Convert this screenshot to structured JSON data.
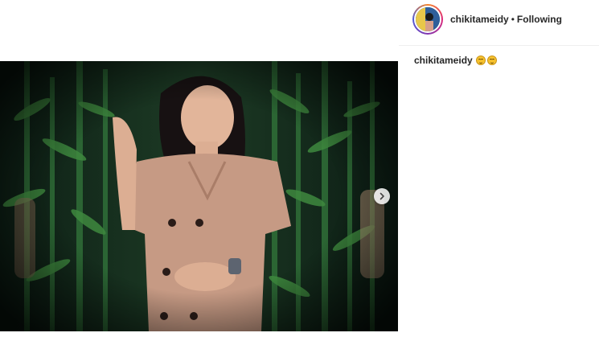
{
  "post": {
    "username": "chikitameidy",
    "separator": "•",
    "follow_status": "Following"
  },
  "caption": {
    "username": "chikitameidy",
    "emojis": [
      "grinning-face-emoji",
      "grinning-face-emoji"
    ]
  },
  "media": {
    "description_icon": "photo",
    "next_icon": "chevron-right-icon"
  },
  "colors": {
    "text": "#262626",
    "border": "#efefef",
    "dress": "#c69a84",
    "foliage": "#2d6a33"
  }
}
